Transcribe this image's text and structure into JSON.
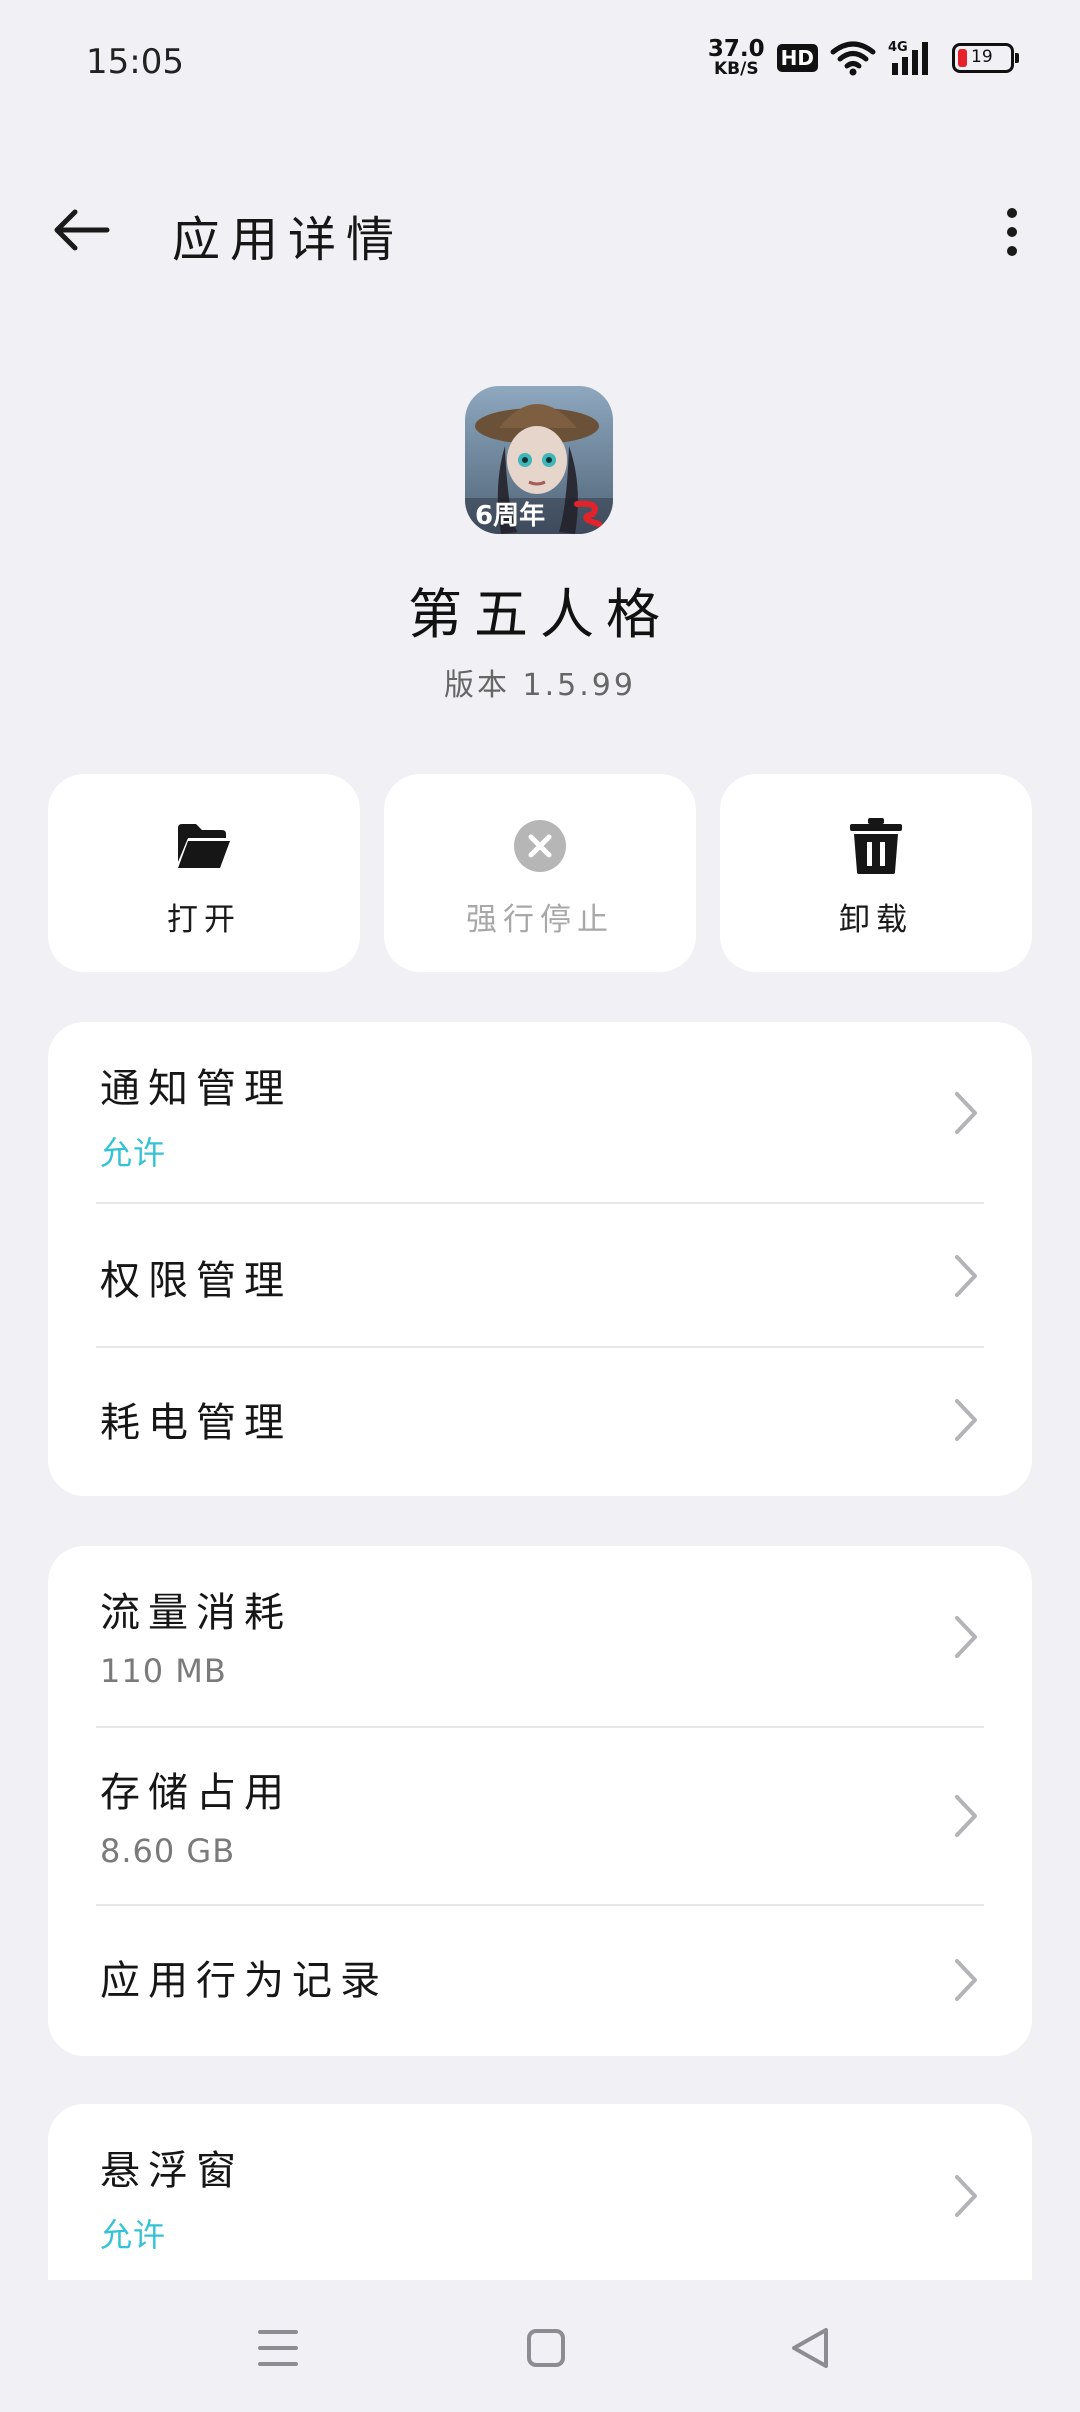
{
  "status_bar": {
    "time": "15:05",
    "net_speed_value": "37.0",
    "net_speed_unit": "KB/S",
    "hd": "HD",
    "network": "4G",
    "battery_level": "19",
    "battery_color": "#e5212a"
  },
  "header": {
    "title": "应用详情",
    "back_icon": "back-arrow-icon",
    "more_icon": "more-vertical-icon"
  },
  "app": {
    "name": "第五人格",
    "version": "版本 1.5.99",
    "icon_badge": "6周年"
  },
  "actions": [
    {
      "label": "打开",
      "icon": "folder-open-icon",
      "enabled": true
    },
    {
      "label": "强行停止",
      "icon": "force-stop-icon",
      "enabled": false
    },
    {
      "label": "卸载",
      "icon": "trash-icon",
      "enabled": true
    }
  ],
  "card1": [
    {
      "title": "通知管理",
      "sub": "允许"
    },
    {
      "title": "权限管理"
    },
    {
      "title": "耗电管理"
    }
  ],
  "card2": [
    {
      "title": "流量消耗",
      "sub": "110 MB"
    },
    {
      "title": "存储占用",
      "sub": "8.60 GB"
    },
    {
      "title": "应用行为记录"
    }
  ],
  "card3": [
    {
      "title": "悬浮窗",
      "sub": "允许"
    }
  ],
  "nav": {
    "menu_icon": "menu-icon",
    "home_icon": "home-square-icon",
    "back_icon": "nav-back-triangle-icon"
  },
  "colors": {
    "accent": "#34c3d6",
    "background": "#f1f1f5",
    "card": "#ffffff"
  }
}
